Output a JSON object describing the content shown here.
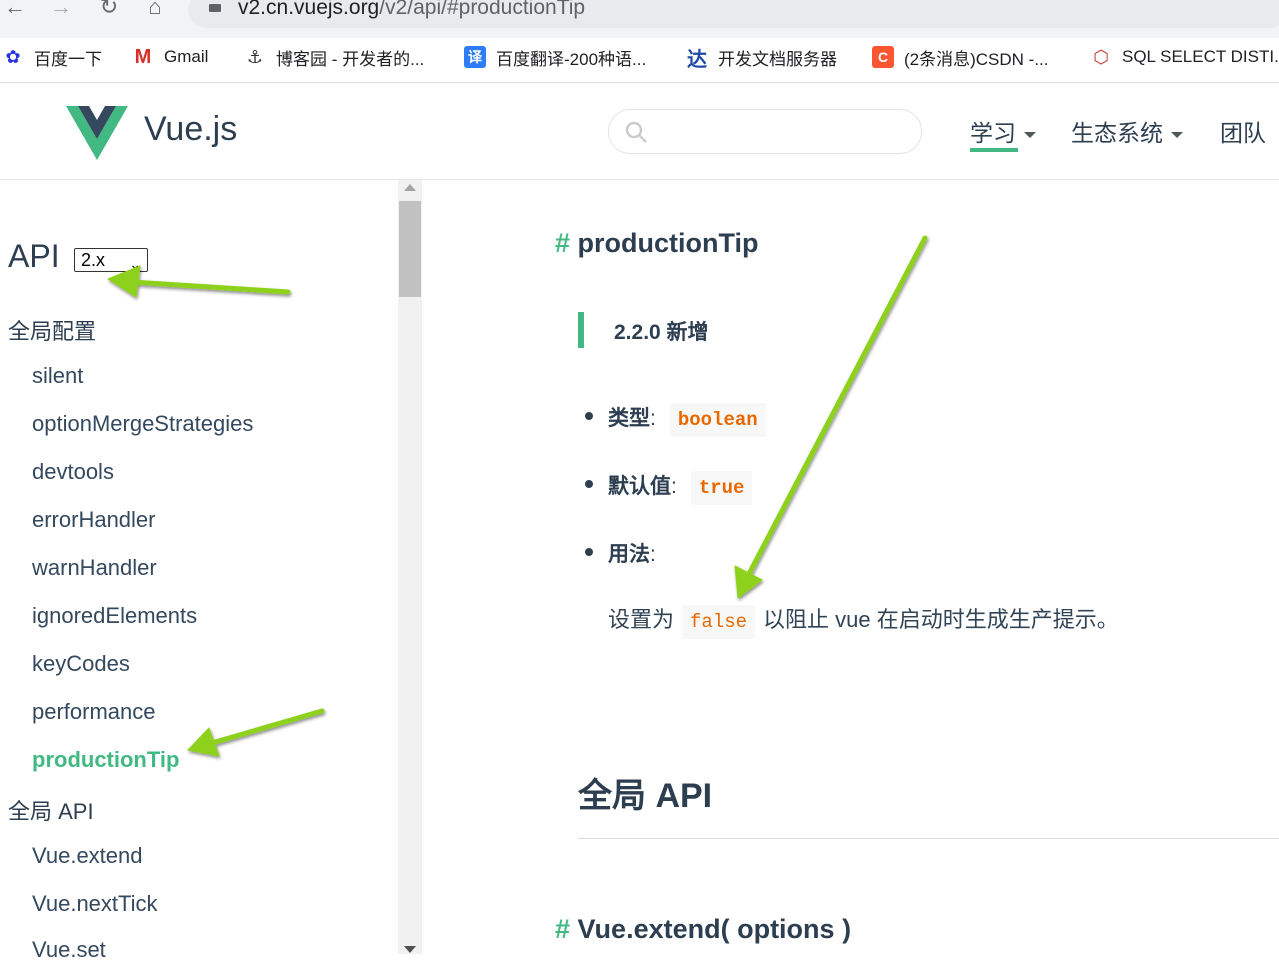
{
  "browser": {
    "url_main": "v2.cn.vuejs.org",
    "url_path": "/v2/api/#productionTip",
    "bookmarks": [
      {
        "icon": "baidu-icon",
        "label": "百度一下"
      },
      {
        "icon": "gmail-icon",
        "label": "Gmail"
      },
      {
        "icon": "cnblogs-icon",
        "label": "博客园 - 开发者的..."
      },
      {
        "icon": "translate-icon",
        "label": "百度翻译-200种语..."
      },
      {
        "icon": "docs-server-icon",
        "label": "开发文档服务器"
      },
      {
        "icon": "csdn-icon",
        "label": "(2条消息)CSDN -..."
      },
      {
        "icon": "sql-icon",
        "label": "SQL SELECT DISTI..."
      }
    ],
    "bookmark_icon_glyphs": {
      "translate": "译",
      "docs": "达",
      "csdn": "C",
      "gmail": "M"
    }
  },
  "header": {
    "logo_text": "Vue.js",
    "nav": [
      {
        "label": "学习",
        "dropdown": true,
        "active": true
      },
      {
        "label": "生态系统",
        "dropdown": true,
        "active": false
      },
      {
        "label": "团队",
        "dropdown": false,
        "active": false
      }
    ],
    "search_placeholder": ""
  },
  "sidebar": {
    "title": "API",
    "version": "2.x",
    "sections": [
      {
        "label": "全局配置",
        "items": [
          "silent",
          "optionMergeStrategies",
          "devtools",
          "errorHandler",
          "warnHandler",
          "ignoredElements",
          "keyCodes",
          "performance",
          "productionTip"
        ]
      },
      {
        "label": "全局 API",
        "items": [
          "Vue.extend",
          "Vue.nextTick",
          "Vue.set"
        ]
      }
    ],
    "active_item": "productionTip"
  },
  "content": {
    "hash": "#",
    "heading": "productionTip",
    "tip": "2.2.0 新增",
    "type_label": "类型",
    "type_value": "boolean",
    "default_label": "默认值",
    "default_value": "true",
    "usage_label": "用法",
    "colon": ":",
    "usage_pre": "设置为",
    "usage_code": "false",
    "usage_post": "以阻止 vue 在启动时生成生产提示。",
    "global_heading": "全局 API",
    "next_heading": "Vue.extend( options )"
  },
  "colors": {
    "accent": "#42b983",
    "code": "#e96900",
    "annotation_arrow": "#8ed11a"
  }
}
